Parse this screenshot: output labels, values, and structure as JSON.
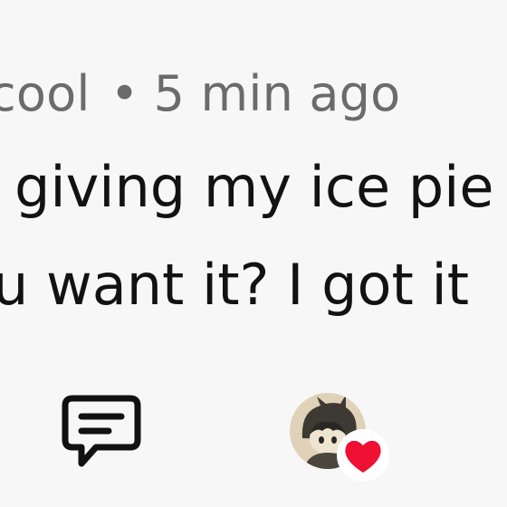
{
  "post": {
    "author_fragment": "cool",
    "separator": "•",
    "timestamp": "5 min ago",
    "body_line_1": "giving my ice pie",
    "body_line_2": "u want it? I got it"
  },
  "actions": {
    "comment_icon": "comment-bubble-icon",
    "reaction_icon": "heart-icon",
    "reaction_color": "#ee1133"
  },
  "colors": {
    "meta_text": "#6b6b6b",
    "body_text": "#121212",
    "background": "#f7f7f7"
  }
}
